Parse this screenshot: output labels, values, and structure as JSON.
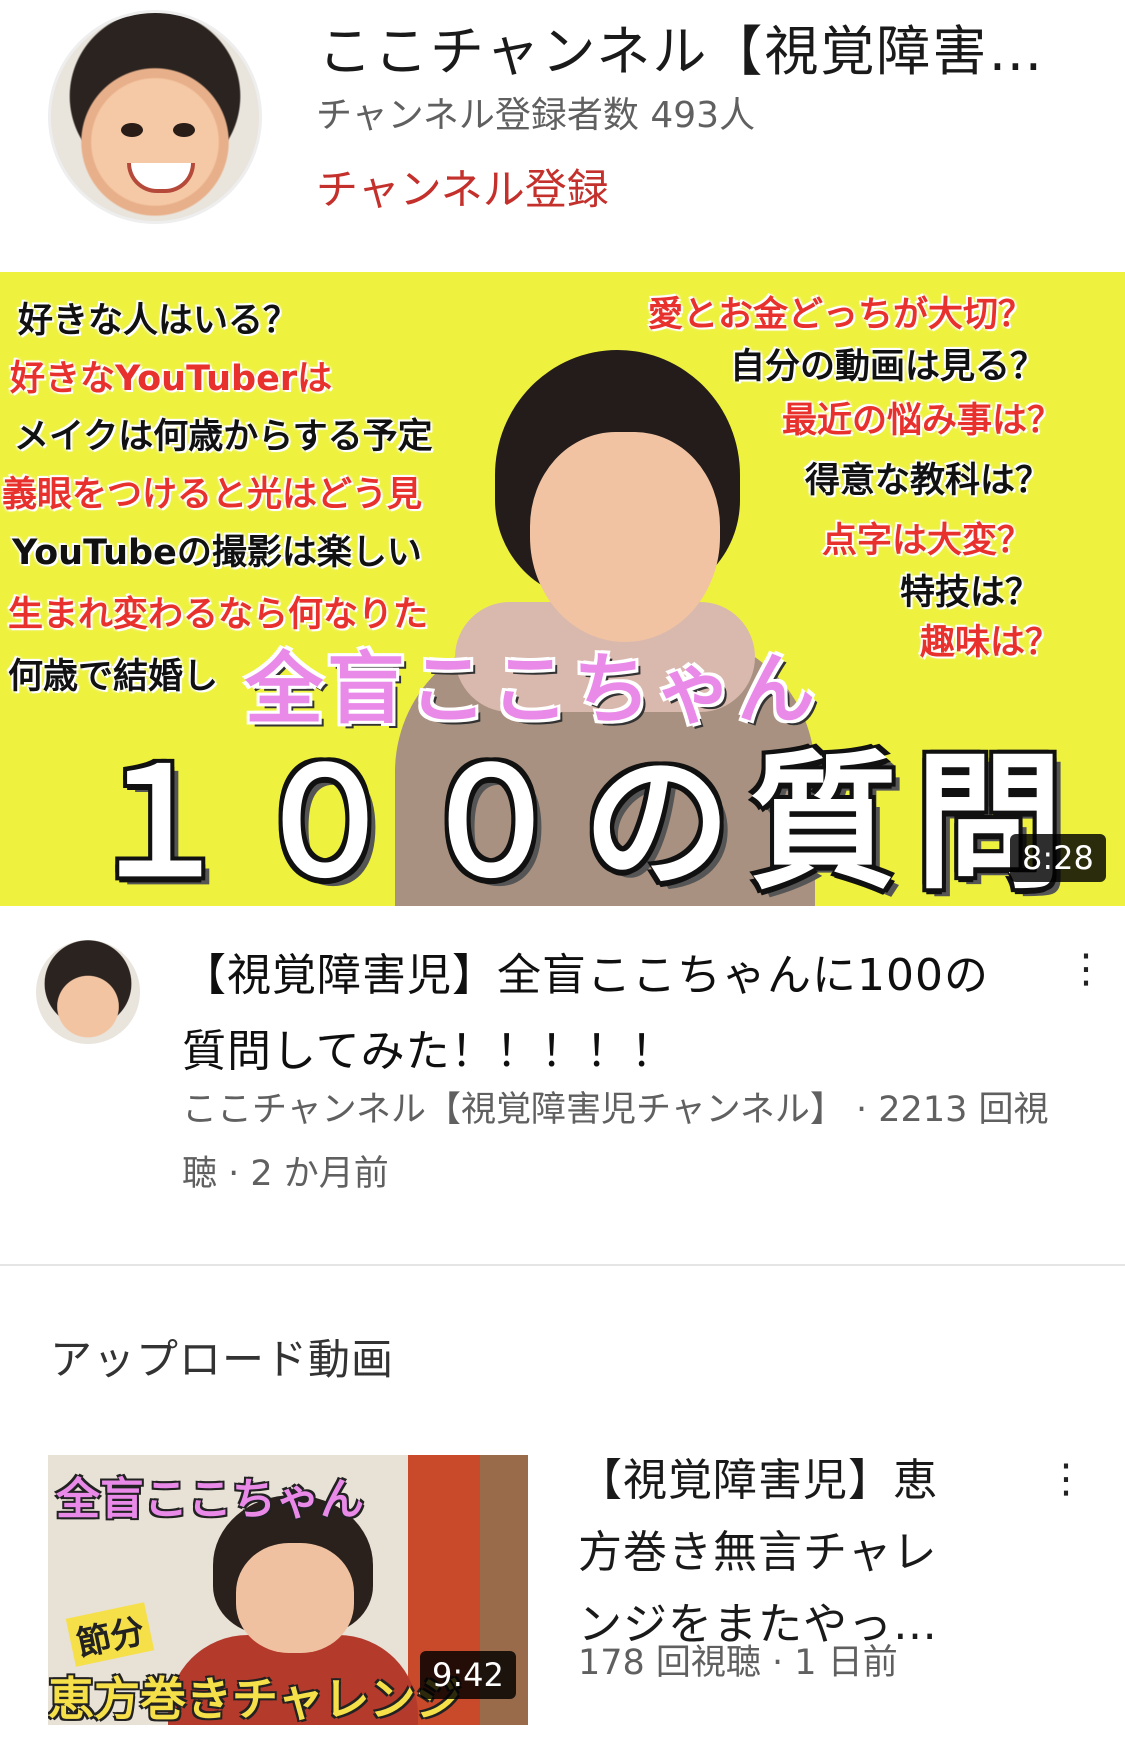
{
  "channel": {
    "name": "ここチャンネル【視覚障害…",
    "subscribers": "チャンネル登録者数 493人",
    "subscribe_label": "チャンネル登録"
  },
  "featured": {
    "thumbnail": {
      "questions_left": [
        {
          "text": "好きな人はいる？",
          "color": "#111111"
        },
        {
          "text": "好きなYouTuberは",
          "color": "#e8302c"
        },
        {
          "text": "メイクは何歳からする予定",
          "color": "#111111"
        },
        {
          "text": "義眼をつけると光はどう見",
          "color": "#e8302c"
        },
        {
          "text": "YouTubeの撮影は楽しい",
          "color": "#111111"
        },
        {
          "text": "生まれ変わるなら何なりた",
          "color": "#e8302c"
        },
        {
          "text": "何歳で結婚し",
          "color": "#111111"
        }
      ],
      "questions_right": [
        {
          "text": "愛とお金どっちが大切？",
          "color": "#e8302c"
        },
        {
          "text": "自分の動画は見る？",
          "color": "#111111"
        },
        {
          "text": "最近の悩み事は？",
          "color": "#e8302c"
        },
        {
          "text": "得意な教科は？",
          "color": "#111111"
        },
        {
          "text": "点字は大変？",
          "color": "#e8302c"
        },
        {
          "text": "特技は？",
          "color": "#111111"
        },
        {
          "text": "趣味は？",
          "color": "#e8302c"
        }
      ],
      "overlay_pink": "全盲ここちゃん",
      "overlay_big": "１００の質問",
      "duration": "8:28"
    },
    "title": "【視覚障害児】全盲ここちゃんに100の質問してみた！！！！！",
    "meta": "ここチャンネル【視覚障害児チャンネル】 · 2213 回視聴 · 2 か月前",
    "menu_icon": "⋮"
  },
  "uploads": {
    "section_title": "アップロード動画",
    "items": [
      {
        "thumb_pink": "全盲ここちゃん",
        "thumb_badge": "節分",
        "thumb_bottom": "恵方巻きチャレンジ",
        "duration": "9:42",
        "title": "【視覚障害児】恵方巻き無言チャレンジをまたやっ…",
        "meta": "178 回視聴 · 1 日前",
        "menu_icon": "⋮"
      }
    ]
  }
}
